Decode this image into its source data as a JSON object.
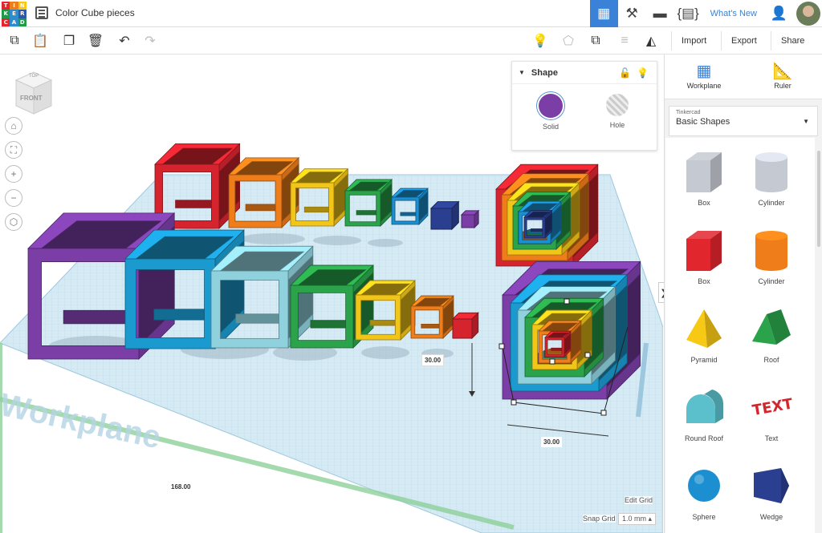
{
  "app": {
    "logo_letters": [
      "T",
      "I",
      "N",
      "K",
      "E",
      "R",
      "C",
      "A",
      "D"
    ],
    "logo_colors": [
      "#e2262e",
      "#ef7d1a",
      "#f7c814",
      "#1e9a48",
      "#2c8ccc",
      "#2f59a8",
      "#e2262e",
      "#2c8ccc",
      "#1e9a48"
    ],
    "design_title": "Color Cube pieces",
    "whats_new": "What's New"
  },
  "toolbar": {
    "import_label": "Import",
    "export_label": "Export",
    "share_label": "Share"
  },
  "viewcube": {
    "top": "TOP",
    "front": "FRONT"
  },
  "inspector": {
    "title": "Shape",
    "solid_label": "Solid",
    "hole_label": "Hole",
    "solid_color": "#7a3ea6"
  },
  "viewport": {
    "workplane_label": "Workplane",
    "dim_height": "30.00",
    "dim_width": "30.00",
    "dim_grid": "168.00",
    "edit_grid": "Edit Grid",
    "snap_grid_label": "Snap Grid",
    "snap_grid_value": "1.0 mm"
  },
  "panel": {
    "workplane_label": "Workplane",
    "ruler_label": "Ruler",
    "library_source": "Tinkercad",
    "library_name": "Basic Shapes",
    "shapes": [
      {
        "label": "Box",
        "color": "#c5cad2"
      },
      {
        "label": "Cylinder",
        "color": "#c5cad2"
      },
      {
        "label": "Box",
        "color": "#e2262e"
      },
      {
        "label": "Cylinder",
        "color": "#ef7d1a"
      },
      {
        "label": "Pyramid",
        "color": "#f7c814"
      },
      {
        "label": "Roof",
        "color": "#2aa34a"
      },
      {
        "label": "Round Roof",
        "color": "#5cc0cc"
      },
      {
        "label": "Text",
        "color": "#d1262e"
      },
      {
        "label": "Sphere",
        "color": "#1b8fd0"
      },
      {
        "label": "Wedge",
        "color": "#2a3f8f"
      }
    ]
  }
}
